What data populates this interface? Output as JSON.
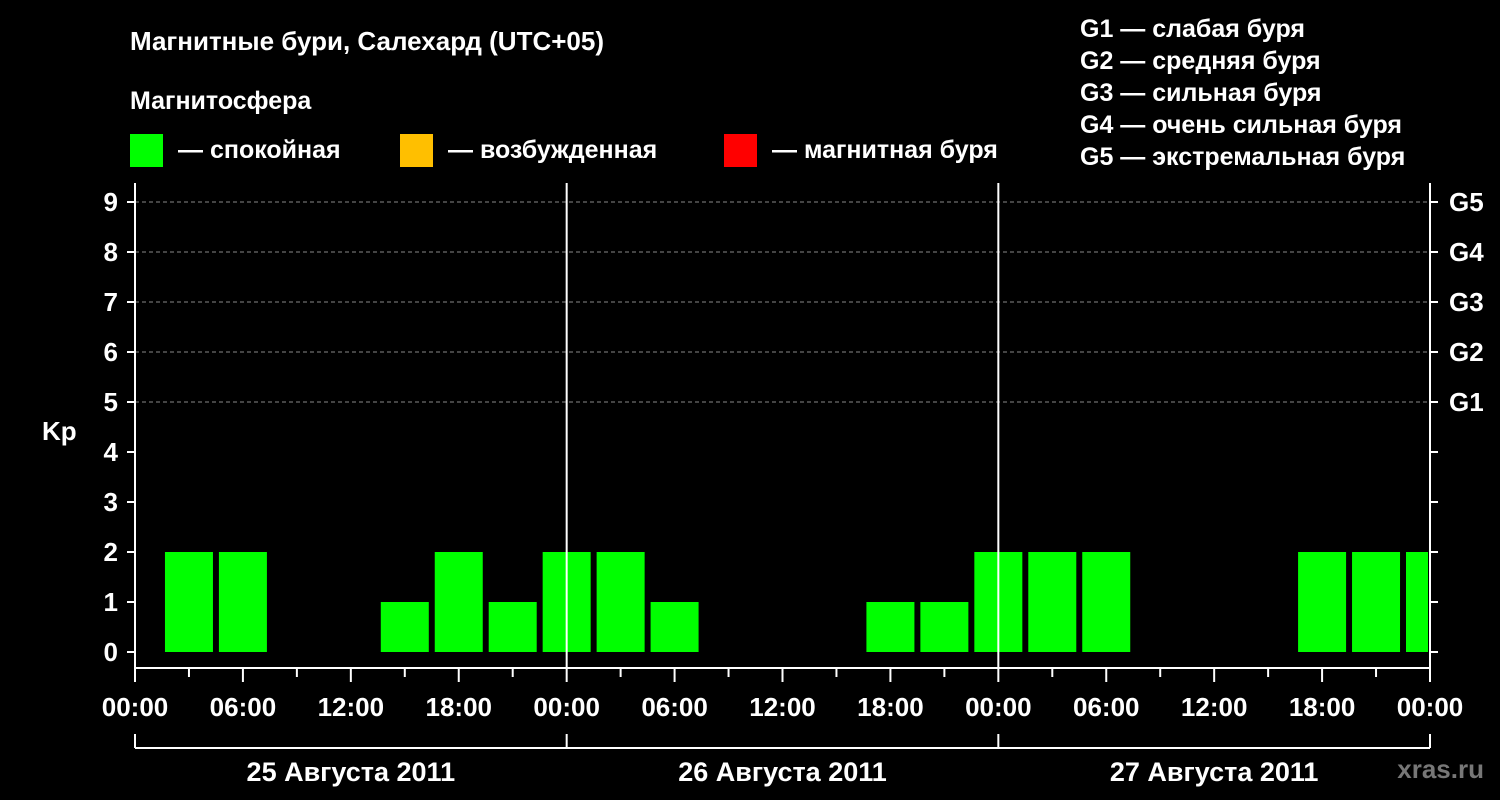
{
  "chart_data": {
    "type": "bar",
    "title": "Магнитные бури, Салехард (UTC+05)",
    "ylabel": "Kp",
    "ylim": [
      0,
      9
    ],
    "yticks": [
      0,
      1,
      2,
      3,
      4,
      5,
      6,
      7,
      8,
      9
    ],
    "right_ticks": [
      {
        "value": 5,
        "label": "G1"
      },
      {
        "value": 6,
        "label": "G2"
      },
      {
        "value": 7,
        "label": "G3"
      },
      {
        "value": 8,
        "label": "G4"
      },
      {
        "value": 9,
        "label": "G5"
      }
    ],
    "xlim_hours": [
      0,
      72
    ],
    "x_tick_labels": [
      "00:00",
      "06:00",
      "12:00",
      "18:00",
      "00:00",
      "06:00",
      "12:00",
      "18:00",
      "00:00",
      "06:00",
      "12:00",
      "18:00",
      "00:00"
    ],
    "days": [
      "25 Августа 2011",
      "26 Августа 2011",
      "27 Августа 2011"
    ],
    "bar_hours": [
      0,
      3,
      6,
      9,
      12,
      15,
      18,
      21,
      24,
      27,
      30,
      33,
      36,
      39,
      42,
      45,
      48,
      51,
      54,
      57,
      60,
      63,
      66,
      69,
      72
    ],
    "values": [
      0,
      2,
      2,
      0,
      0,
      1,
      2,
      1,
      2,
      2,
      1,
      0,
      0,
      0,
      1,
      1,
      2,
      2,
      2,
      0,
      0,
      0,
      2,
      2,
      2
    ],
    "grid": "dashed horizontal",
    "legend_title": "Магнитосфера",
    "legend": [
      {
        "label": "— спокойная",
        "color": "#00ff00"
      },
      {
        "label": "— возбужденная",
        "color": "#ffbf00"
      },
      {
        "label": "— магнитная буря",
        "color": "#ff0000"
      }
    ],
    "storm_scale": [
      "G1 — слабая буря",
      "G2 — средняя буря",
      "G3 — сильная буря",
      "G4 — очень сильная буря",
      "G5 — экстремальная буря"
    ],
    "watermark": "xras.ru"
  },
  "colors": {
    "background": "#000000",
    "quiet": "#00ff00",
    "grid": "#888888",
    "axis": "#ffffff",
    "watermark": "#777777"
  }
}
